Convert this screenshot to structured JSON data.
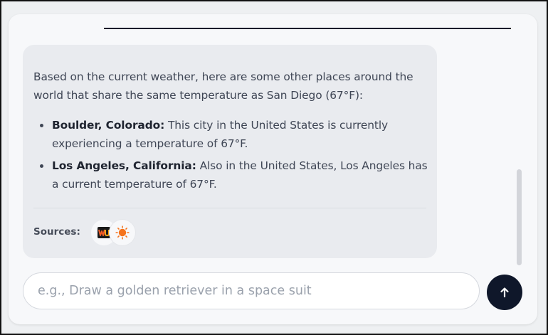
{
  "message": {
    "intro": "Based on the current weather, here are some other places around the world that share the same temperature as San Diego (67°F):",
    "items": [
      {
        "place": "Boulder, Colorado:",
        "detail": " This city in the United States is currently experiencing a temperature of 67°F."
      },
      {
        "place": "Los Angeles, California:",
        "detail": " Also in the United States, Los Angeles has a current temperature of 67°F."
      }
    ],
    "sources_label": "Sources:",
    "sources": [
      {
        "icon": "weather-underground-icon",
        "brand_color": "#f15a24"
      },
      {
        "icon": "sun-icon",
        "brand_color": "#f5731c"
      }
    ]
  },
  "composer": {
    "placeholder": "e.g., Draw a golden retriever in a space suit",
    "value": ""
  },
  "send_button": {
    "icon": "arrow-up-icon",
    "color": "#0f172a"
  },
  "colors": {
    "accent": "#0f172a",
    "bubble": "#e9ebef",
    "card": "#f7f8fa"
  }
}
